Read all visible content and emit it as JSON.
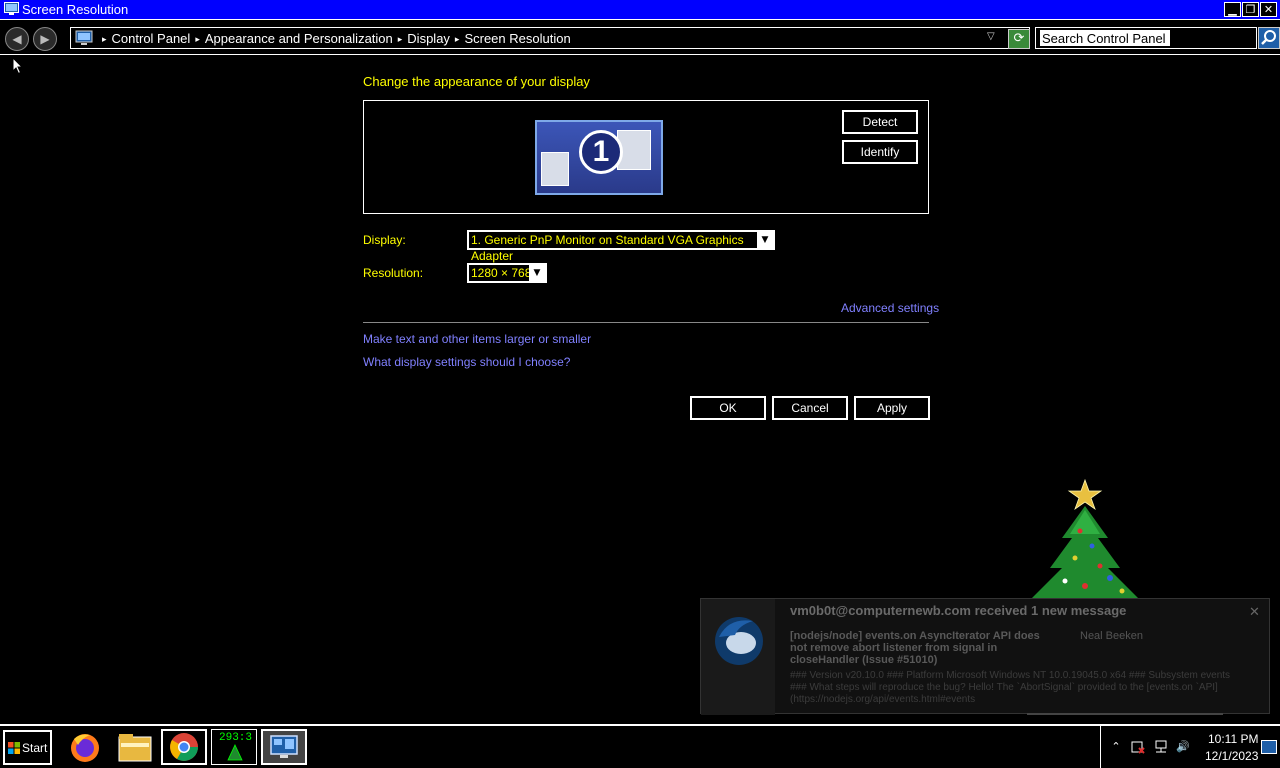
{
  "window": {
    "title": "Screen Resolution",
    "minimize_glyph": "▁",
    "restore_glyph": "❐",
    "close_glyph": "✕"
  },
  "addressbar": {
    "back_glyph": "◀",
    "forward_glyph": "▶",
    "breadcrumb": [
      "Control Panel",
      "Appearance and Personalization",
      "Display",
      "Screen Resolution"
    ],
    "separator_glyph": "▸",
    "dropdown_glyph": "▽",
    "refresh_glyph": "⟳",
    "search_placeholder": "Search Control Panel"
  },
  "main": {
    "heading": "Change the appearance of your display",
    "monitor_number": "1",
    "detect_label": "Detect",
    "identify_label": "Identify",
    "display_label": "Display:",
    "display_value": "1. Generic PnP Monitor on Standard VGA Graphics Adapter",
    "resolution_label": "Resolution:",
    "resolution_value": "1280 × 768",
    "dropdown_glyph": "▼",
    "advanced_link": "Advanced settings",
    "text_size_link": "Make text and other items larger or smaller",
    "help_link": "What display settings should I choose?",
    "ok_label": "OK",
    "cancel_label": "Cancel",
    "apply_label": "Apply"
  },
  "notification": {
    "title": "vm0b0t@computernewb.com received 1 new message",
    "close_glyph": "✕",
    "subject": "[nodejs/node] events.on AsyncIterator API does not remove abort listener from signal in closeHandler (Issue #51010)",
    "sender": "Neal Beeken",
    "body": "### Version v20.10.0 ### Platform Microsoft Windows NT 10.0.19045.0 x64 ### Subsystem events ### What steps will reproduce the bug? Hello! The `AbortSignal` provided to the [events.on `API](https://nodejs.org/api/events.html#events"
  },
  "taskbar": {
    "start_label": "Start",
    "gpu_counter": "293:3",
    "tray_up_glyph": "⌃",
    "volume_glyph": "🔊",
    "clock_time": "10:11 PM",
    "clock_date": "12/1/2023"
  },
  "colors": {
    "titlebar": "#0000ff",
    "heading": "#ffff00",
    "link": "#8080ff",
    "background": "#000000"
  },
  "icons": [
    "control-panel-icon",
    "monitor-icon",
    "search-icon",
    "refresh-icon",
    "thunderbird-icon",
    "firefox-icon",
    "file-explorer-icon",
    "chrome-icon",
    "christmas-tree-icon",
    "windows-flag-icon"
  ]
}
